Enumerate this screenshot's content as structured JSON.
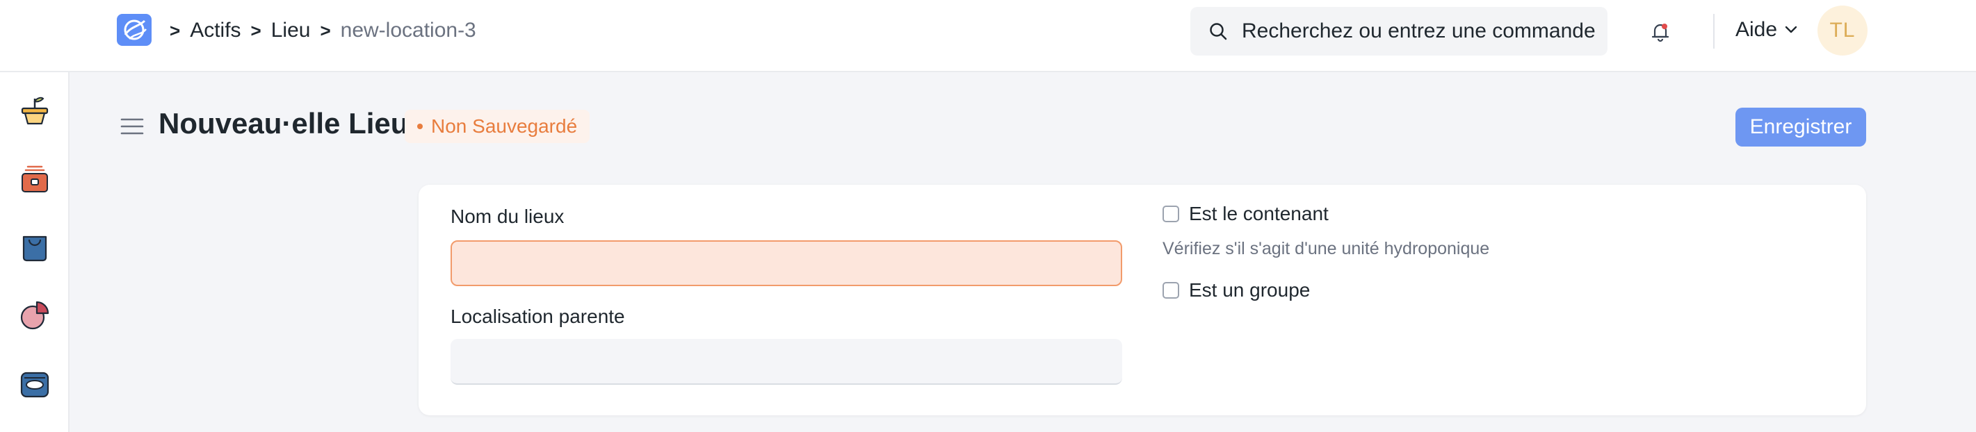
{
  "breadcrumb": {
    "items": [
      "Actifs",
      "Lieu",
      "new-location-3"
    ],
    "separator": ">"
  },
  "search": {
    "placeholder": "Recherchez ou entrez une commande"
  },
  "header": {
    "help_label": "Aide",
    "avatar_initials": "TL"
  },
  "page": {
    "title": "Nouveau·elle Lieu",
    "status": "Non Sauvegardé",
    "save_label": "Enregistrer"
  },
  "form": {
    "location_name_label": "Nom du lieux",
    "location_name_value": "",
    "parent_location_label": "Localisation parente",
    "parent_location_value": "",
    "is_container_label": "Est le contenant",
    "is_container_checked": false,
    "is_container_hint": "Vérifiez s'il s'agit d'une unité hydroponique",
    "is_group_label": "Est un groupe",
    "is_group_checked": false
  },
  "sidebar": {
    "items": [
      {
        "icon": "plant-pot-icon"
      },
      {
        "icon": "asset-box-icon"
      },
      {
        "icon": "stock-bag-icon"
      },
      {
        "icon": "pie-chart-icon"
      },
      {
        "icon": "tray-icon"
      }
    ]
  },
  "colors": {
    "primary": "#6e97f2",
    "status_orange": "#e87d3e",
    "error_bg": "#fde6dc",
    "avatar_bg": "#fdf1dc"
  }
}
